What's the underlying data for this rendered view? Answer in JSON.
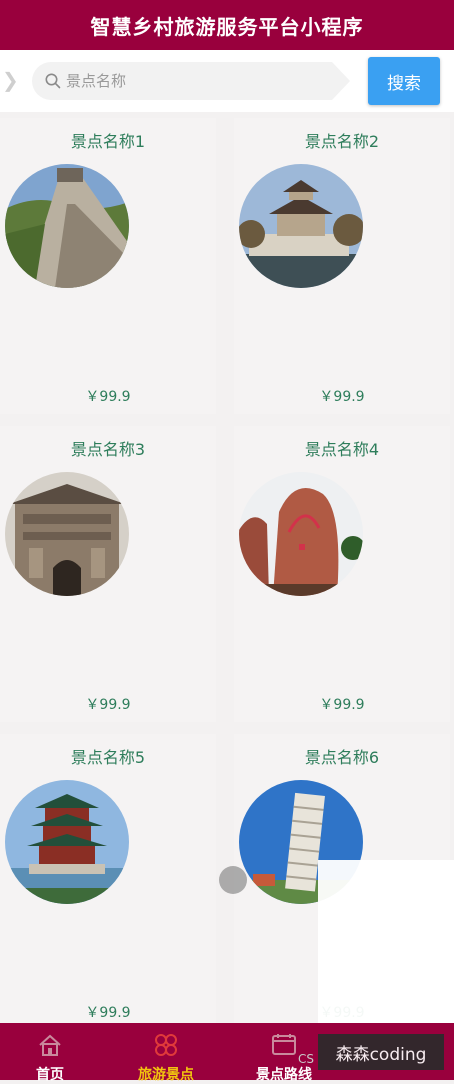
{
  "header": {
    "title": "智慧乡村旅游服务平台小程序"
  },
  "search": {
    "placeholder": "景点名称",
    "button_label": "搜索"
  },
  "attractions": [
    {
      "name": "景点名称1",
      "price": "￥99.9",
      "image": "great-wall-photo"
    },
    {
      "name": "景点名称2",
      "price": "￥99.9",
      "image": "pavilion-temple-photo"
    },
    {
      "name": "景点名称3",
      "price": "￥99.9",
      "image": "stone-gate-photo"
    },
    {
      "name": "景点名称4",
      "price": "￥99.9",
      "image": "red-rock-photo"
    },
    {
      "name": "景点名称5",
      "price": "￥99.9",
      "image": "pagoda-tower-photo"
    },
    {
      "name": "景点名称6",
      "price": "￥99.9",
      "image": "leaning-tower-photo"
    }
  ],
  "tabbar": {
    "tabs": [
      {
        "label": "首页",
        "icon": "home-icon",
        "active": false
      },
      {
        "label": "旅游景点",
        "icon": "attractions-icon",
        "active": true
      },
      {
        "label": "景点路线",
        "icon": "route-icon",
        "active": false
      }
    ]
  },
  "overlay": {
    "tag": "CS",
    "watermark": "森森coding"
  },
  "colors": {
    "brand": "#99003d",
    "accent": "#f1c40f",
    "search_button": "#3aa0f2",
    "text_green": "#2e7d5b"
  }
}
